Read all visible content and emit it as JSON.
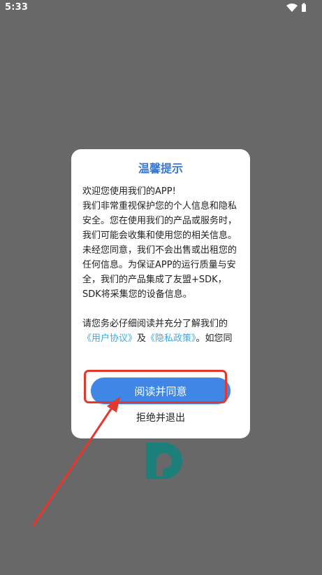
{
  "status_bar": {
    "time": "5:33",
    "icons": [
      "wifi-icon",
      "battery-icon"
    ]
  },
  "dialog": {
    "title": "温馨提示",
    "paragraph_1": "欢迎您使用我们的APP!",
    "paragraph_2": "我们非常重视保护您的个人信息和隐私安全。您在使用我们的产品或服务时，我们可能会收集和使用您的相关信息。未经您同意，我们不会出售或出租您的任何信息。为保证APP的运行质量与安全，我们的产品集成了友盟+SDK，SDK将采集您的设备信息。",
    "paragraph_3_prefix": "请您务必仔细阅读并充分了解我们的",
    "user_agreement_link": "《用户协议》",
    "and_text": "及",
    "privacy_policy_link": "《隐私政策》",
    "paragraph_3_suffix": "。如您同",
    "agree_label": "阅读并同意",
    "reject_label": "拒绝并退出"
  },
  "colors": {
    "overlay": "#686868",
    "title": "#3a78d6",
    "agree_button": "#3f86e6",
    "link": "#3ea9e6",
    "annotation": "#e5382d",
    "logo": "#1d7f7a"
  }
}
